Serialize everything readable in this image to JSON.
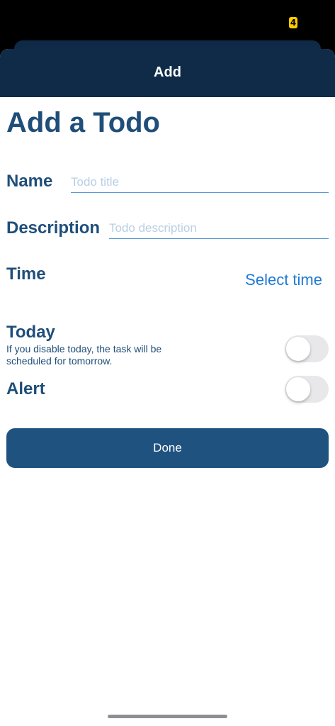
{
  "status_bar": {
    "battery_indicator": "4"
  },
  "header": {
    "title": "Add"
  },
  "form": {
    "page_title": "Add a Todo",
    "name": {
      "label": "Name",
      "placeholder": "Todo title",
      "value": ""
    },
    "description": {
      "label": "Description",
      "placeholder": "Todo description",
      "value": ""
    },
    "time": {
      "label": "Time",
      "action_label": "Select time"
    },
    "today": {
      "label": "Today",
      "hint": "If you disable today, the task will be scheduled for tomorrow.",
      "enabled": false
    },
    "alert": {
      "label": "Alert",
      "enabled": false
    },
    "done_label": "Done"
  },
  "colors": {
    "header_background": "#0f2b48",
    "label_text": "#1f4e79",
    "link": "#1e7ad6",
    "button_background": "#20527f",
    "toggle_off": "#e8e8ea"
  }
}
